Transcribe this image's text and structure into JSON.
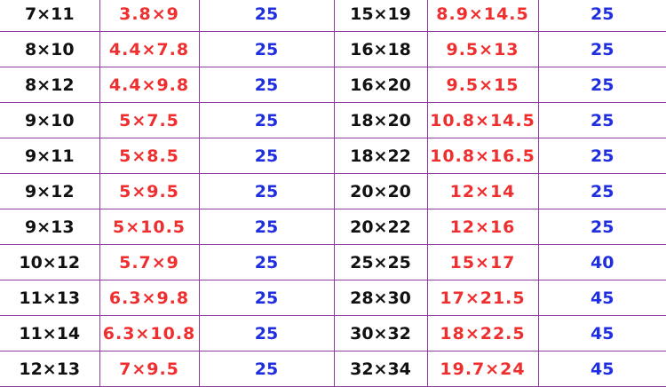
{
  "colors": {
    "size": "#111111",
    "dim": "#ef2f2f",
    "qty": "#1f2fe0",
    "border": "#8e3aa0"
  },
  "rows": [
    {
      "a_size": "7×11",
      "a_dim": "3.8×9",
      "a_qty": "25",
      "b_size": "15×19",
      "b_dim": "8.9×14.5",
      "b_qty": "25"
    },
    {
      "a_size": "8×10",
      "a_dim": "4.4×7.8",
      "a_qty": "25",
      "b_size": "16×18",
      "b_dim": "9.5×13",
      "b_qty": "25"
    },
    {
      "a_size": "8×12",
      "a_dim": "4.4×9.8",
      "a_qty": "25",
      "b_size": "16×20",
      "b_dim": "9.5×15",
      "b_qty": "25"
    },
    {
      "a_size": "9×10",
      "a_dim": "5×7.5",
      "a_qty": "25",
      "b_size": "18×20",
      "b_dim": "10.8×14.5",
      "b_qty": "25"
    },
    {
      "a_size": "9×11",
      "a_dim": "5×8.5",
      "a_qty": "25",
      "b_size": "18×22",
      "b_dim": "10.8×16.5",
      "b_qty": "25"
    },
    {
      "a_size": "9×12",
      "a_dim": "5×9.5",
      "a_qty": "25",
      "b_size": "20×20",
      "b_dim": "12×14",
      "b_qty": "25"
    },
    {
      "a_size": "9×13",
      "a_dim": "5×10.5",
      "a_qty": "25",
      "b_size": "20×22",
      "b_dim": "12×16",
      "b_qty": "25"
    },
    {
      "a_size": "10×12",
      "a_dim": "5.7×9",
      "a_qty": "25",
      "b_size": "25×25",
      "b_dim": "15×17",
      "b_qty": "40"
    },
    {
      "a_size": "11×13",
      "a_dim": "6.3×9.8",
      "a_qty": "25",
      "b_size": "28×30",
      "b_dim": "17×21.5",
      "b_qty": "45"
    },
    {
      "a_size": "11×14",
      "a_dim": "6.3×10.8",
      "a_qty": "25",
      "b_size": "30×32",
      "b_dim": "18×22.5",
      "b_qty": "45"
    },
    {
      "a_size": "12×13",
      "a_dim": "7×9.5",
      "a_qty": "25",
      "b_size": "32×34",
      "b_dim": "19.7×24",
      "b_qty": "45"
    }
  ]
}
